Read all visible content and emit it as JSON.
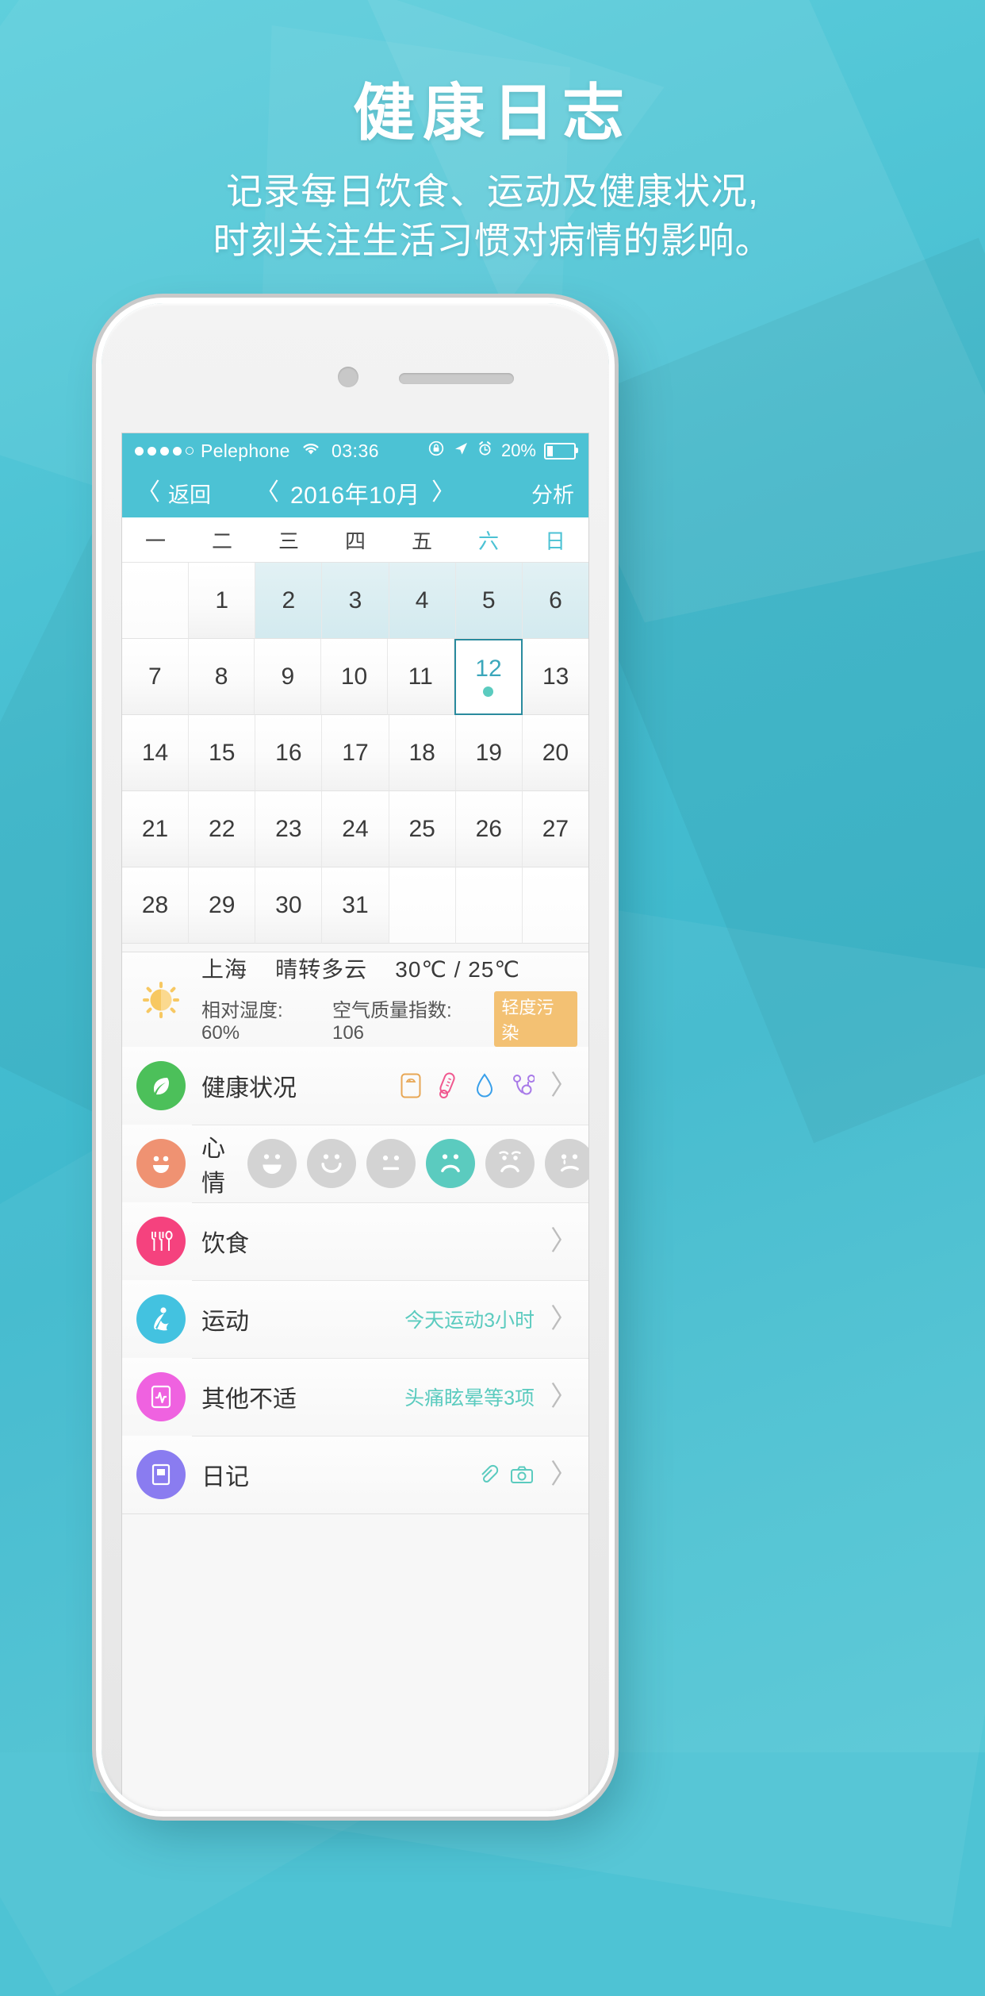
{
  "hero": {
    "title": "健康日志",
    "subtitle_line1": "记录每日饮食、运动及健康状况,",
    "subtitle_line2": "时刻关注生活习惯对病情的影响。"
  },
  "statusbar": {
    "carrier": "Pelephone",
    "wifi_icon": "wifi-icon",
    "time": "03:36",
    "rotation_lock_icon": "rotation-lock-icon",
    "location_icon": "location-arrow-icon",
    "alarm_icon": "alarm-clock-icon",
    "battery_percent": "20%",
    "battery_icon": "battery-icon"
  },
  "navbar": {
    "back_label": "返回",
    "back_chevron": "〈",
    "prev_chevron": "〈",
    "title": "2016年10月",
    "next_chevron": "〉",
    "right_action": "分析"
  },
  "calendar": {
    "weekdays": [
      {
        "label": "一",
        "weekend": false
      },
      {
        "label": "二",
        "weekend": false
      },
      {
        "label": "三",
        "weekend": false
      },
      {
        "label": "四",
        "weekend": false
      },
      {
        "label": "五",
        "weekend": false
      },
      {
        "label": "六",
        "weekend": true
      },
      {
        "label": "日",
        "weekend": true
      }
    ],
    "rows": [
      [
        {
          "day": "",
          "state": "empty"
        },
        {
          "day": "1",
          "state": "plain"
        },
        {
          "day": "2",
          "state": "shade"
        },
        {
          "day": "3",
          "state": "shade"
        },
        {
          "day": "4",
          "state": "shade"
        },
        {
          "day": "5",
          "state": "shade"
        },
        {
          "day": "6",
          "state": "shade"
        }
      ],
      [
        {
          "day": "7",
          "state": "plain"
        },
        {
          "day": "8",
          "state": "plain"
        },
        {
          "day": "9",
          "state": "plain"
        },
        {
          "day": "10",
          "state": "plain"
        },
        {
          "day": "11",
          "state": "plain"
        },
        {
          "day": "12",
          "state": "selected",
          "dot": true
        },
        {
          "day": "13",
          "state": "plain"
        }
      ],
      [
        {
          "day": "14",
          "state": "plain"
        },
        {
          "day": "15",
          "state": "plain"
        },
        {
          "day": "16",
          "state": "plain"
        },
        {
          "day": "17",
          "state": "plain"
        },
        {
          "day": "18",
          "state": "plain"
        },
        {
          "day": "19",
          "state": "plain"
        },
        {
          "day": "20",
          "state": "plain"
        }
      ],
      [
        {
          "day": "21",
          "state": "plain"
        },
        {
          "day": "22",
          "state": "plain"
        },
        {
          "day": "23",
          "state": "plain"
        },
        {
          "day": "24",
          "state": "plain"
        },
        {
          "day": "25",
          "state": "plain"
        },
        {
          "day": "26",
          "state": "plain"
        },
        {
          "day": "27",
          "state": "plain"
        }
      ],
      [
        {
          "day": "28",
          "state": "plain"
        },
        {
          "day": "29",
          "state": "plain"
        },
        {
          "day": "30",
          "state": "plain"
        },
        {
          "day": "31",
          "state": "plain"
        },
        {
          "day": "",
          "state": "empty"
        },
        {
          "day": "",
          "state": "empty"
        },
        {
          "day": "",
          "state": "empty"
        }
      ]
    ]
  },
  "weather": {
    "icon": "sun-behind-cloud-icon",
    "city": "上海",
    "condition": "晴转多云",
    "temperature": "30℃ / 25℃",
    "humidity": "相对湿度: 60%",
    "aqi": "空气质量指数: 106",
    "aqi_badge": "轻度污染",
    "badge_color": "#f3c173"
  },
  "list": {
    "health": {
      "label": "健康状况",
      "icon": "leaf-icon",
      "icon_color": "#4cc05a",
      "mini_icons": [
        "weight-scale-icon",
        "thermometer-icon",
        "blood-drop-icon",
        "stethoscope-icon"
      ],
      "arrow": "〉"
    },
    "mood": {
      "label": "心情",
      "icon": "smiley-face-icon",
      "icon_color": "#ef9272",
      "faces": [
        "grin",
        "smile",
        "neutral",
        "frown",
        "worried",
        "sad"
      ],
      "selected_index": 3,
      "selected_color": "#5bcbbf",
      "inactive_color": "#d3d3d3"
    },
    "diet": {
      "label": "饮食",
      "icon": "cutlery-icon",
      "icon_color": "#f5427e",
      "value": "",
      "arrow": "〉"
    },
    "exercise": {
      "label": "运动",
      "icon": "running-person-icon",
      "icon_color": "#43c2e0",
      "value": "今天运动3小时",
      "arrow": "〉"
    },
    "discomfort": {
      "label": "其他不适",
      "icon": "heartbeat-monitor-icon",
      "icon_color": "#ef62e0",
      "value": "头痛眩晕等3项",
      "arrow": "〉"
    },
    "diary": {
      "label": "日记",
      "icon": "notebook-icon",
      "icon_color": "#8a7cf0",
      "value": "",
      "arrow": "〉"
    }
  },
  "colors": {
    "brand_teal": "#4cc2d4",
    "accent_mint": "#5bcbbf",
    "selected_border": "#2a8b9e",
    "shade_cell": "#d8edf1"
  }
}
